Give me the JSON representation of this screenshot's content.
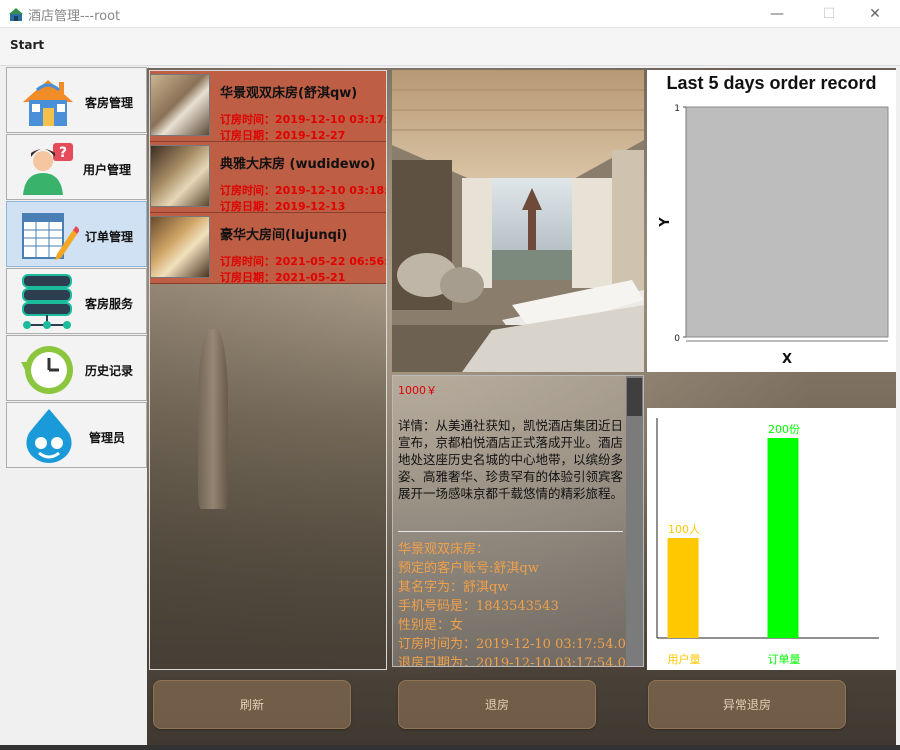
{
  "window": {
    "title": "酒店管理---root",
    "minimize_label": "—",
    "maximize_label": "☐",
    "close_label": "✕"
  },
  "menu": {
    "start": "Start"
  },
  "sidebar": {
    "items": [
      {
        "label": "客房管理",
        "icon": "house-icon"
      },
      {
        "label": "用户管理",
        "icon": "user-question-icon"
      },
      {
        "label": "订单管理",
        "icon": "order-form-icon",
        "active": true
      },
      {
        "label": "客房服务",
        "icon": "server-icon"
      },
      {
        "label": "历史记录",
        "icon": "history-icon"
      },
      {
        "label": "管理员",
        "icon": "drupal-drop-icon"
      }
    ]
  },
  "orders": [
    {
      "room": "华景观双床房(舒淇qw)",
      "time_line": "订房时间：2019-12-10 03:17:",
      "date_line": "订房日期：2019-12-27"
    },
    {
      "room": "典雅大床房 (wudidewo)",
      "time_line": "订房时间：2019-12-10 03:18:",
      "date_line": "订房日期：2019-12-13"
    },
    {
      "room": "豪华大房间(lujunqi)",
      "time_line": "订房时间：2021-05-22 06:56:",
      "date_line": "订房日期：2021-05-21"
    }
  ],
  "detail": {
    "price": "1000￥",
    "description": "详情：从美通社获知，凯悦酒店集团近日宣布，京都柏悦酒店正式落成开业。酒店地处这座历史名城的中心地带，以缤纷多姿、高雅奢华、珍贵罕有的体验引领宾客展开一场感味京都千载悠情的精彩旅程。",
    "info": [
      "华景观双床房：",
      "预定的客户账号:舒淇qw",
      "其名字为：舒淇qw",
      "手机号码是：1843543543",
      "性别是：女",
      "订房时间为：2019-12-10 03:17:54.0",
      "退房日期为：2019-12-10 03:17:54.0"
    ]
  },
  "chart_data": [
    {
      "type": "line",
      "title": "Last 5 days order record",
      "xlabel": "X",
      "ylabel": "Y",
      "ylim": [
        0,
        1
      ],
      "y_ticks": [
        "0",
        "1"
      ],
      "series": [],
      "plot_background": "#bdbdbd"
    },
    {
      "type": "bar",
      "categories": [
        "用户量",
        "订单量"
      ],
      "values": [
        100,
        200
      ],
      "data_labels": [
        "100人",
        "200份"
      ],
      "colors": [
        "#ffc800",
        "#00ff00"
      ],
      "ylim": [
        0,
        200
      ]
    }
  ],
  "buttons": {
    "refresh": "刷新",
    "checkout": "退房",
    "abnormal_checkout": "异常退房"
  }
}
